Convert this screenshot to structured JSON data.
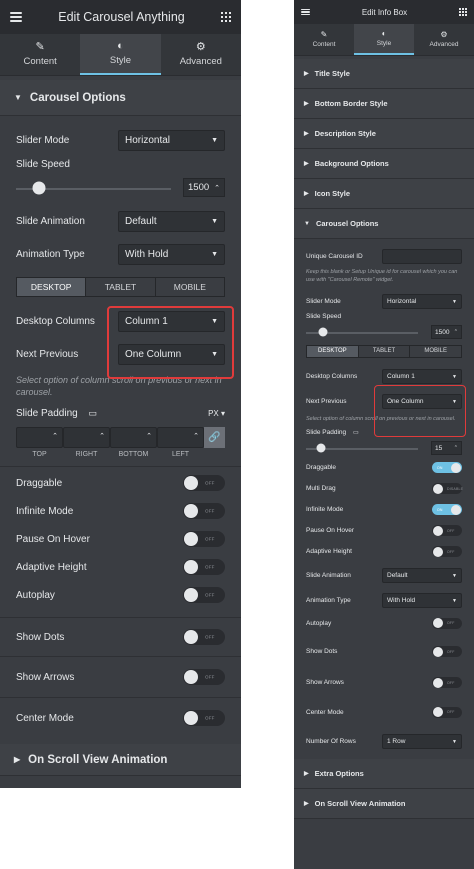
{
  "left": {
    "title": "Edit Carousel Anything",
    "tabs": [
      {
        "label": "Content",
        "icon": "pencil-icon"
      },
      {
        "label": "Style",
        "icon": "half-circle-icon"
      },
      {
        "label": "Advanced",
        "icon": "gear-icon"
      }
    ],
    "section_title": "Carousel Options",
    "slider_mode": {
      "label": "Slider Mode",
      "value": "Horizontal"
    },
    "slide_speed": {
      "label": "Slide Speed",
      "value": "1500"
    },
    "slide_animation": {
      "label": "Slide Animation",
      "value": "Default"
    },
    "animation_type": {
      "label": "Animation Type",
      "value": "With Hold"
    },
    "devices": [
      "DESKTOP",
      "TABLET",
      "MOBILE"
    ],
    "desktop_columns": {
      "label": "Desktop Columns",
      "value": "Column 1"
    },
    "next_previous": {
      "label": "Next Previous",
      "value": "One Column"
    },
    "hint": "Select option of column scroll on previous or next in carousel.",
    "slide_padding": {
      "label": "Slide Padding",
      "unit": "PX",
      "sides": [
        "TOP",
        "RIGHT",
        "BOTTOM",
        "LEFT"
      ]
    },
    "toggles": [
      "Draggable",
      "Infinite Mode",
      "Pause On Hover",
      "Adaptive Height",
      "Autoplay",
      "Show Dots",
      "Show Arrows",
      "Center Mode"
    ],
    "toggle_text": "OFF",
    "bottom_section": "On Scroll View Animation"
  },
  "right": {
    "title": "Edit Info Box",
    "tabs": [
      {
        "label": "Content",
        "icon": "pencil-icon"
      },
      {
        "label": "Style",
        "icon": "half-circle-icon"
      },
      {
        "label": "Advanced",
        "icon": "gear-icon"
      }
    ],
    "sections": [
      "Title Style",
      "Bottom Border Style",
      "Description Style",
      "Background Options",
      "Icon Style",
      "Carousel Options"
    ],
    "unique_id_label": "Unique Carousel ID",
    "unique_id_hint": "Keep this blank or Setup Unique id for carousel which you can use with \"Carousel Remote\" widget.",
    "slider_mode": {
      "label": "Slider Mode",
      "value": "Horizontal"
    },
    "slide_speed": {
      "label": "Slide Speed",
      "value": "1500"
    },
    "devices": [
      "DESKTOP",
      "TABLET",
      "MOBILE"
    ],
    "desktop_columns": {
      "label": "Desktop Columns",
      "value": "Column 1"
    },
    "next_previous": {
      "label": "Next Previous",
      "value": "One Column"
    },
    "hint": "Select option of column scroll on previous or next in carousel.",
    "slide_padding": {
      "label": "Slide Padding",
      "value": "15"
    },
    "toggles": [
      {
        "label": "Draggable",
        "state": "ON"
      },
      {
        "label": "Multi Drag",
        "state": "DISABLE"
      },
      {
        "label": "Infinite Mode",
        "state": "ON"
      },
      {
        "label": "Pause On Hover",
        "state": "OFF"
      },
      {
        "label": "Adaptive Height",
        "state": "OFF"
      }
    ],
    "slide_animation": {
      "label": "Slide Animation",
      "value": "Default"
    },
    "animation_type": {
      "label": "Animation Type",
      "value": "With Hold"
    },
    "toggles2": [
      {
        "label": "Autoplay",
        "state": "OFF"
      },
      {
        "label": "Show Dots",
        "state": "OFF"
      },
      {
        "label": "Show Arrows",
        "state": "OFF"
      },
      {
        "label": "Center Mode",
        "state": "OFF"
      }
    ],
    "number_of_rows": {
      "label": "Number Of Rows",
      "value": "1 Row"
    },
    "bottom_sections": [
      "Extra Options",
      "On Scroll View Animation"
    ]
  },
  "colors": {
    "highlight": "#e03b3b",
    "accent": "#6ec1e4",
    "panel": "#3a3d42"
  }
}
